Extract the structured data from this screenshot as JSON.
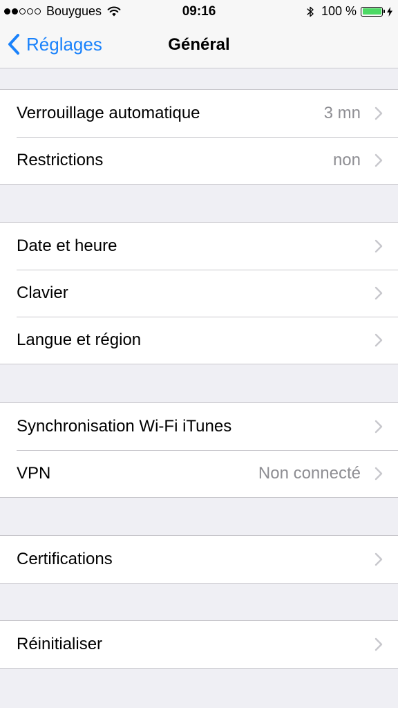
{
  "colors": {
    "accent": "#1a82fb",
    "battery": "#4cd964",
    "chevron": "#c7c7cc",
    "value_text": "#8e8e93"
  },
  "status_bar": {
    "signal_filled": 2,
    "signal_total": 5,
    "carrier": "Bouygues",
    "wifi_icon": "wifi-icon",
    "time": "09:16",
    "bluetooth_icon": "bluetooth-icon",
    "battery_percent": "100 %",
    "battery_level": 1.0,
    "charging_icon": "bolt-icon"
  },
  "nav": {
    "back_label": "Réglages",
    "title": "Général"
  },
  "groups": [
    {
      "items": [
        {
          "label": "Verrouillage automatique",
          "value": "3 mn"
        },
        {
          "label": "Restrictions",
          "value": "non"
        }
      ]
    },
    {
      "items": [
        {
          "label": "Date et heure",
          "value": ""
        },
        {
          "label": "Clavier",
          "value": ""
        },
        {
          "label": "Langue et région",
          "value": ""
        }
      ]
    },
    {
      "items": [
        {
          "label": "Synchronisation Wi-Fi iTunes",
          "value": ""
        },
        {
          "label": "VPN",
          "value": "Non connecté"
        }
      ]
    },
    {
      "items": [
        {
          "label": "Certifications",
          "value": ""
        }
      ]
    },
    {
      "items": [
        {
          "label": "Réinitialiser",
          "value": ""
        }
      ]
    }
  ]
}
